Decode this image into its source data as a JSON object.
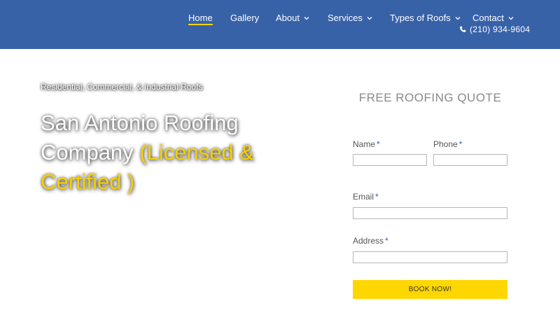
{
  "colors": {
    "header_bg": "#3762a8",
    "accent": "#f6d000",
    "button_bg": "#ffd700"
  },
  "nav": {
    "items": [
      {
        "label": "Home",
        "active": true,
        "dropdown": false
      },
      {
        "label": "Gallery",
        "dropdown": false
      },
      {
        "label": "About",
        "dropdown": true
      },
      {
        "label": "Services",
        "dropdown": true
      },
      {
        "label": "Types of Roofs",
        "dropdown": true
      },
      {
        "label": "Contact",
        "dropdown": true
      }
    ],
    "phone": "(210) 934-9604",
    "phone_icon": "phone-icon"
  },
  "hero": {
    "subtitle": "Residential, Commercial, & Industrial Roofs",
    "title": "San Antonio Roofing Company",
    "title_accent": "(Licensed & Certified )"
  },
  "quote_form": {
    "title": "FREE ROOFING QUOTE",
    "required_mark": "*",
    "fields": {
      "name": {
        "label": "Name",
        "value": ""
      },
      "phone": {
        "label": "Phone",
        "value": ""
      },
      "email": {
        "label": "Email",
        "value": ""
      },
      "address": {
        "label": "Address",
        "value": ""
      }
    },
    "submit_label": "BOOK NOW!"
  }
}
